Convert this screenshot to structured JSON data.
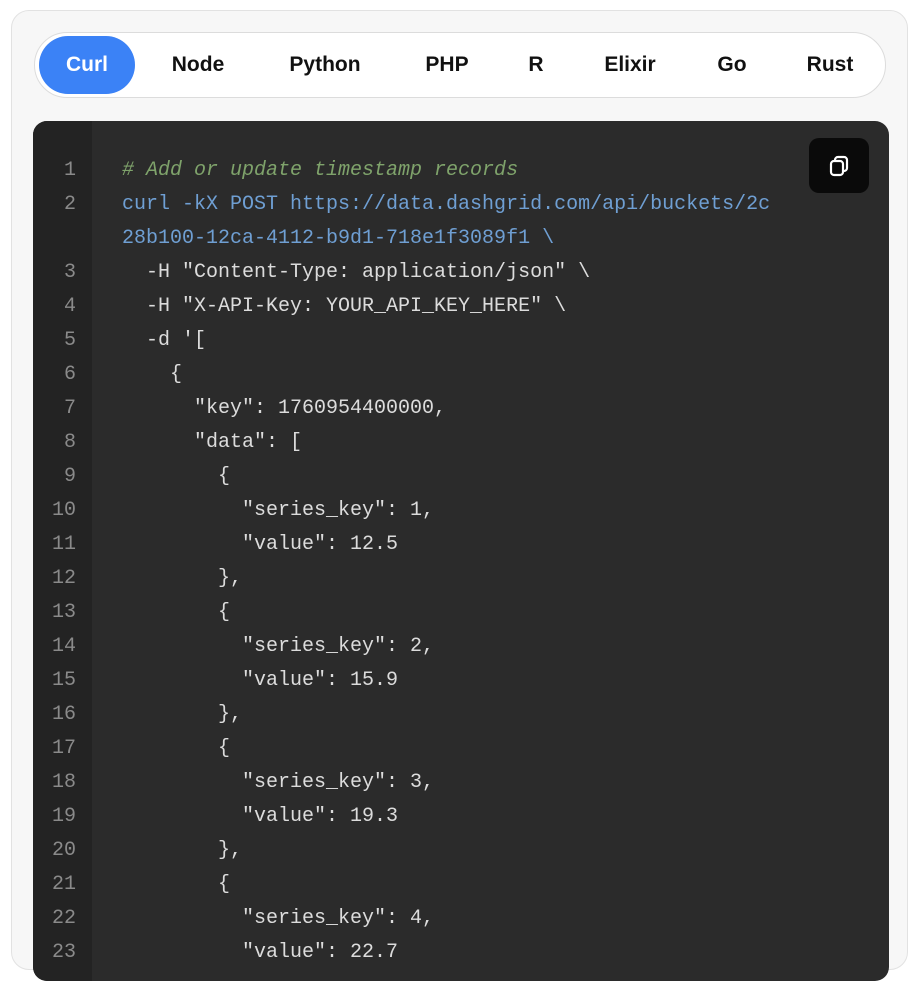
{
  "tabs": [
    {
      "label": "Curl",
      "active": true
    },
    {
      "label": "Node",
      "active": false
    },
    {
      "label": "Python",
      "active": false
    },
    {
      "label": "PHP",
      "active": false
    },
    {
      "label": "R",
      "active": false
    },
    {
      "label": "Elixir",
      "active": false
    },
    {
      "label": "Go",
      "active": false
    },
    {
      "label": "Rust",
      "active": false
    }
  ],
  "copy_button": {
    "icon": "copy-icon"
  },
  "colors": {
    "accent": "#3b82f6",
    "code_bg": "#2b2b2b",
    "gutter_bg": "#232323",
    "comment": "#7fa36b",
    "url": "#6f9fd3",
    "string": "#d1906e",
    "plain": "#dcdcdc"
  },
  "code_lines": [
    {
      "num": "1",
      "text": "# Add or update timestamp records",
      "kind": "comment"
    },
    {
      "num": "2",
      "text": "curl -kX POST https://data.dashgrid.com/api/buckets/2c",
      "kind": "url"
    },
    {
      "num": "",
      "text": "28b100-12ca-4112-b9d1-718e1f3089f1 \\",
      "kind": "url"
    },
    {
      "num": "3",
      "text": "  -H \"Content-Type: application/json\" \\",
      "kind": "plain"
    },
    {
      "num": "4",
      "text": "  -H \"X-API-Key: YOUR_API_KEY_HERE\" \\",
      "kind": "plain"
    },
    {
      "num": "5",
      "text": "  -d '[",
      "kind": "plain"
    },
    {
      "num": "6",
      "text": "    {",
      "kind": "plain"
    },
    {
      "num": "7",
      "text": "      \"key\": 1760954400000,",
      "kind": "string"
    },
    {
      "num": "8",
      "text": "      \"data\": [",
      "kind": "string"
    },
    {
      "num": "9",
      "text": "        {",
      "kind": "plain"
    },
    {
      "num": "10",
      "text": "          \"series_key\": 1,",
      "kind": "string"
    },
    {
      "num": "11",
      "text": "          \"value\": 12.5",
      "kind": "string"
    },
    {
      "num": "12",
      "text": "        },",
      "kind": "plain"
    },
    {
      "num": "13",
      "text": "        {",
      "kind": "plain"
    },
    {
      "num": "14",
      "text": "          \"series_key\": 2,",
      "kind": "string"
    },
    {
      "num": "15",
      "text": "          \"value\": 15.9",
      "kind": "string"
    },
    {
      "num": "16",
      "text": "        },",
      "kind": "plain"
    },
    {
      "num": "17",
      "text": "        {",
      "kind": "plain"
    },
    {
      "num": "18",
      "text": "          \"series_key\": 3,",
      "kind": "string"
    },
    {
      "num": "19",
      "text": "          \"value\": 19.3",
      "kind": "string"
    },
    {
      "num": "20",
      "text": "        },",
      "kind": "plain"
    },
    {
      "num": "21",
      "text": "        {",
      "kind": "plain"
    },
    {
      "num": "22",
      "text": "          \"series_key\": 4,",
      "kind": "string"
    },
    {
      "num": "23",
      "text": "          \"value\": 22.7",
      "kind": "string"
    }
  ]
}
